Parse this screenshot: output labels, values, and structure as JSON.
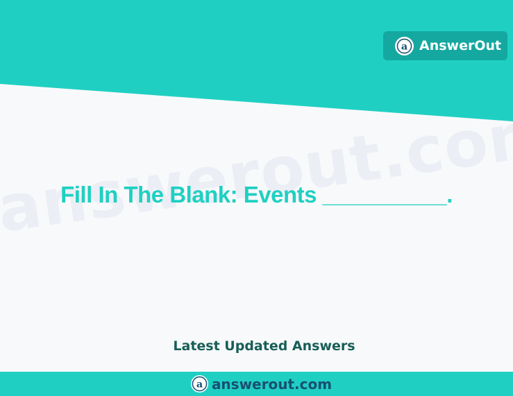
{
  "brand": {
    "name": "AnswerOut",
    "logo_icon": "answerout-a-logo-icon"
  },
  "watermark": {
    "text": "answerout.com"
  },
  "question": {
    "text": "Fill In The Blank: Events __________."
  },
  "tagline": {
    "text": "Latest Updated Answers"
  },
  "footer": {
    "url": "answerout.com"
  },
  "colors": {
    "teal": "#1fd0c2",
    "badge": "#14a8a0",
    "tagline": "#175e56",
    "logo_blue": "#174f73",
    "background": "#f8f9fb"
  }
}
